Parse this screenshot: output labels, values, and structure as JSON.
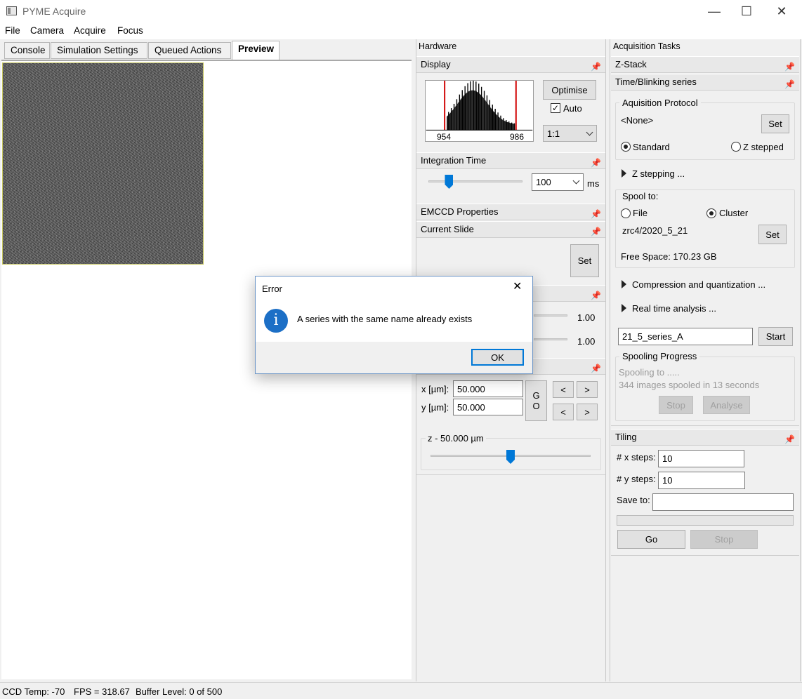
{
  "window": {
    "title": "PYME Acquire",
    "minimize": "—",
    "maximize": "☐",
    "close": "✕"
  },
  "menu": [
    "File",
    "Camera",
    "Acquire",
    "Focus"
  ],
  "tabs": [
    "Console",
    "Simulation Settings",
    "Queued Actions",
    "Preview"
  ],
  "hardware": {
    "title": "Hardware",
    "display": {
      "title": "Display",
      "optimise": "Optimise",
      "auto_label": "Auto",
      "auto_checked": true,
      "zoom": "1:1",
      "hist_min": "954",
      "hist_max": "986"
    },
    "integration": {
      "title": "Integration Time",
      "value": "100",
      "unit": "ms",
      "slider_fraction": 0.22
    },
    "emccd": {
      "title": "EMCCD Properties"
    },
    "current_slide": {
      "title": "Current Slide",
      "set": "Set"
    },
    "hidden_panel": {
      "value1": "1.00",
      "value2": "1.00"
    },
    "positioning": {
      "x_label": "x [µm]:",
      "x_value": "50.000",
      "y_label": "y [µm]:",
      "y_value": "50.000",
      "go_1": "G",
      "go_2": "O",
      "left": "<",
      "right": ">",
      "z_label": "z - 50.000 µm",
      "z_slider_fraction": 0.5
    }
  },
  "acquisition": {
    "title": "Acquisition Tasks",
    "zstack": {
      "title": "Z-Stack"
    },
    "series": {
      "title": "Time/Blinking series",
      "protocol_label": "Aquisition Protocol",
      "protocol_value": "<None>",
      "set": "Set",
      "standard": "Standard",
      "z_stepped": "Z stepped",
      "z_stepping": "Z stepping ...",
      "spool_to": "Spool to:",
      "file": "File",
      "cluster": "Cluster",
      "spool_path": "zrc4/2020_5_21",
      "free_space": "Free Space: 170.23 GB",
      "compression": "Compression and quantization ...",
      "realtime": "Real time analysis ...",
      "series_name": "21_5_series_A",
      "start": "Start",
      "progress_label": "Spooling Progress",
      "spooling_to": "Spooling to .....",
      "spooled": "344 images spooled in 13 seconds",
      "stop": "Stop",
      "analyse": "Analyse"
    },
    "tiling": {
      "title": "Tiling",
      "x_steps_label": "# x steps:",
      "x_steps": "10",
      "y_steps_label": "# y steps:",
      "y_steps": "10",
      "save_to_label": "Save to:",
      "save_to": "",
      "go": "Go",
      "stop": "Stop"
    }
  },
  "status": {
    "ccd_temp": "CCD Temp: -70",
    "fps": "FPS = 318.67",
    "buffer": "Buffer Level: 0 of 500"
  },
  "dialog": {
    "title": "Error",
    "message": "A series with the same name already exists",
    "ok": "OK",
    "close": "✕"
  }
}
